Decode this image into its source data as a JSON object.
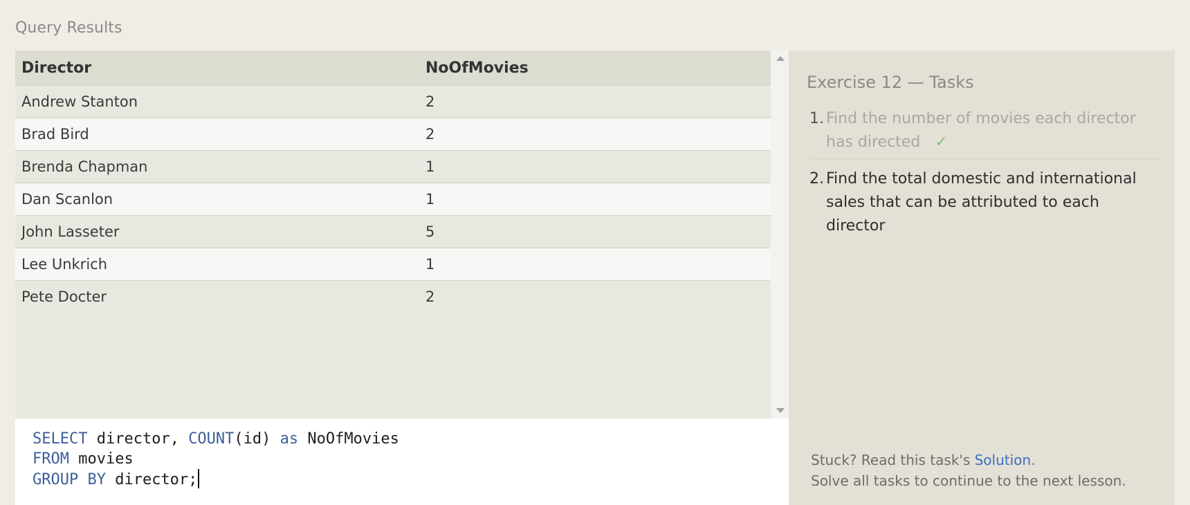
{
  "results": {
    "title": "Query Results",
    "columns": [
      "Director",
      "NoOfMovies"
    ],
    "rows": [
      [
        "Andrew Stanton",
        "2"
      ],
      [
        "Brad Bird",
        "2"
      ],
      [
        "Brenda Chapman",
        "1"
      ],
      [
        "Dan Scanlon",
        "1"
      ],
      [
        "John Lasseter",
        "5"
      ],
      [
        "Lee Unkrich",
        "1"
      ],
      [
        "Pete Docter",
        "2"
      ]
    ]
  },
  "editor": {
    "line1": {
      "kw1": "SELECT",
      "t1": " director, ",
      "kw2": "COUNT",
      "t2": "(id) ",
      "kw3": "as",
      "t3": " NoOfMovies"
    },
    "line2": {
      "kw1": "FROM",
      "t1": " movies"
    },
    "line3": {
      "kw1": "GROUP BY",
      "t1": " director;"
    }
  },
  "tasks": {
    "title": "Exercise 12 — Tasks",
    "items": [
      {
        "num": "1.",
        "text": "Find the number of movies each director has directed",
        "status": "done",
        "check": "✓"
      },
      {
        "num": "2.",
        "text": "Find the total domestic and international sales that can be attributed to each director",
        "status": "todo"
      }
    ]
  },
  "help": {
    "prefix": "Stuck? Read this task's ",
    "link": "Solution",
    "suffix": ".",
    "line2": "Solve all tasks to continue to the next lesson."
  },
  "colors": {
    "keyword": "#3c5f99",
    "link": "#3d6ec0",
    "check": "#7ec47e"
  }
}
